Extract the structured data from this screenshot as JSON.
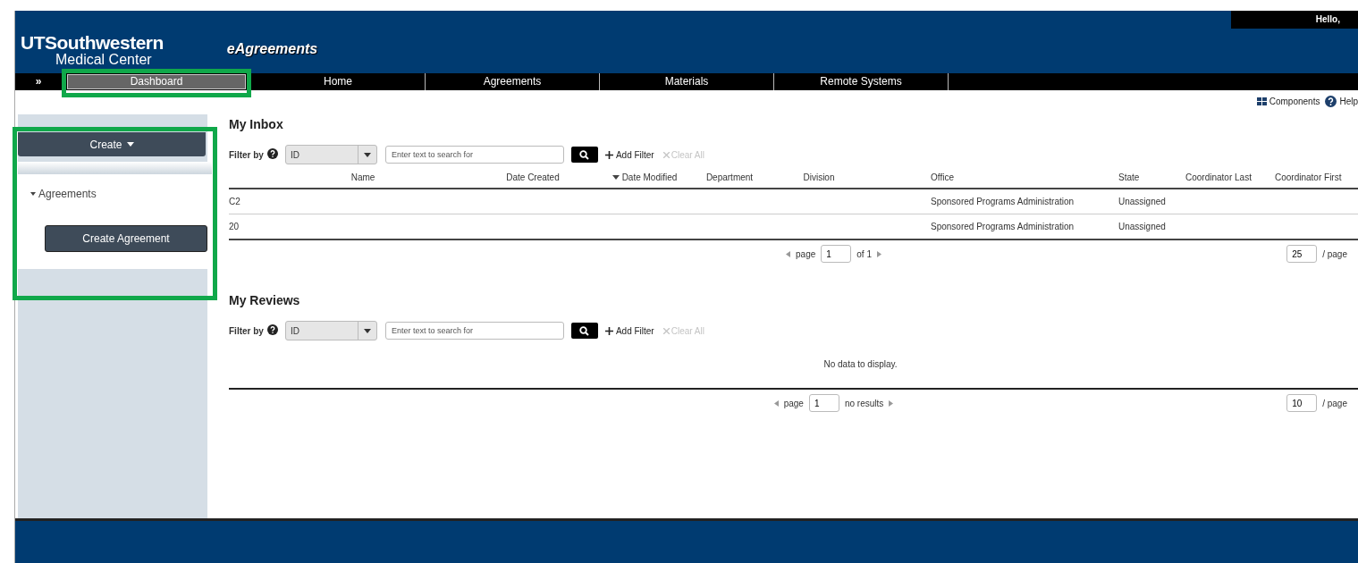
{
  "header": {
    "logo": {
      "line_1": "UTSouthwestern",
      "line_2": "Medical Center"
    },
    "app_title": "eAgreements",
    "greeting": "Hello,"
  },
  "nav": {
    "toggle": "»",
    "tabs": [
      {
        "label": "Dashboard",
        "selected": true,
        "highlighted": true
      },
      {
        "label": "Home",
        "selected": false,
        "highlighted": false
      },
      {
        "label": "Agreements",
        "selected": false,
        "highlighted": false
      },
      {
        "label": "Materials",
        "selected": false,
        "highlighted": false
      },
      {
        "label": "Remote Systems",
        "selected": false,
        "highlighted": false
      }
    ]
  },
  "utility_links": [
    {
      "label": "Components",
      "kind": "components"
    },
    {
      "label": "Help",
      "kind": "help"
    }
  ],
  "create_menu": {
    "button": "Create",
    "expanded": true,
    "highlighted": true,
    "section": {
      "label": "Agreements",
      "expanded": true
    },
    "action": "Create Agreement"
  },
  "inbox": {
    "title": "My Inbox",
    "filter": {
      "label": "Filter by",
      "field": "ID",
      "placeholder": "Enter text to search for",
      "add_filter": "Add Filter",
      "clear_all": {
        "label": "Clear All",
        "disabled": true
      }
    },
    "columns": [
      {
        "label": "Name",
        "sorted": false
      },
      {
        "label": "Date Created",
        "sorted": false
      },
      {
        "label": "Date Modified",
        "sorted": true
      },
      {
        "label": "Department",
        "sorted": false
      },
      {
        "label": "Division",
        "sorted": false
      },
      {
        "label": "Office",
        "sorted": false
      },
      {
        "label": "State",
        "sorted": false
      },
      {
        "label": "Coordinator Last",
        "sorted": false
      },
      {
        "label": "Coordinator First",
        "sorted": false
      }
    ],
    "rows": [
      {
        "id": "C2",
        "office": "Sponsored Programs Administration",
        "state": "Unassigned"
      },
      {
        "id": "20",
        "office": "Sponsored Programs Administration",
        "state": "Unassigned"
      }
    ],
    "pager": {
      "page_label": "page",
      "page": "1",
      "total": "of 1",
      "per_page": "25",
      "per_page_label": "/ page"
    }
  },
  "reviews": {
    "title": "My Reviews",
    "filter": {
      "label": "Filter by",
      "field": "ID",
      "placeholder": "Enter text to search for",
      "add_filter": "Add Filter",
      "clear_all": {
        "label": "Clear All",
        "disabled": true
      }
    },
    "empty_message": "No data to display.",
    "pager": {
      "page_label": "page",
      "page": "1",
      "total": "no results",
      "per_page": "10",
      "per_page_label": "/ page"
    }
  }
}
